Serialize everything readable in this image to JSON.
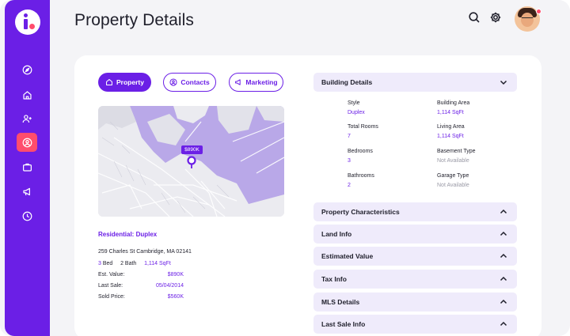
{
  "page_title": "Property Details",
  "tabs": [
    {
      "label": "Property",
      "icon": "home-icon",
      "active": true
    },
    {
      "label": "Contacts",
      "icon": "user-circle-icon",
      "active": false
    },
    {
      "label": "Marketing",
      "icon": "megaphone-icon",
      "active": false
    }
  ],
  "map": {
    "price_pin": "$890K"
  },
  "property": {
    "type": "Residential: Duplex",
    "address": "259 Charles St Cambridge, MA  02141",
    "beds_num": "3",
    "beds_label": "Bed",
    "baths_num": "2",
    "baths_label": "Bath",
    "area": "1,114 SqFt",
    "est_value_label": "Est. Value:",
    "est_value": "$890K",
    "last_sale_label": "Last Sale:",
    "last_sale": "05/04/2014",
    "sold_price_label": "Sold Price:",
    "sold_price": "$560K"
  },
  "building_details": {
    "title": "Building Details",
    "expanded": true,
    "fields": [
      {
        "label": "Style",
        "value": "Duplex"
      },
      {
        "label": "Building Area",
        "value": "1,114 SqFt"
      },
      {
        "label": "Total Rooms",
        "value": "7"
      },
      {
        "label": "Living Area",
        "value": "1,114 SqFt"
      },
      {
        "label": "Bedrooms",
        "value": "3"
      },
      {
        "label": "Basement Type",
        "value": "Not Available"
      },
      {
        "label": "Bathrooms",
        "value": "2"
      },
      {
        "label": "Garage Type",
        "value": "Not Available"
      }
    ]
  },
  "sections": [
    {
      "title": "Property Characteristics"
    },
    {
      "title": "Land Info"
    },
    {
      "title": "Estimated Value"
    },
    {
      "title": "Tax Info"
    },
    {
      "title": "MLS Details"
    },
    {
      "title": "Last Sale Info"
    }
  ],
  "sidebar_icons": [
    "compass-icon",
    "home-icon",
    "user-plus-icon",
    "user-circle-icon",
    "briefcase-icon",
    "megaphone-icon",
    "clock-icon"
  ],
  "colors": {
    "accent": "#6b1fe6",
    "sidebar": "#6b1fe6",
    "highlight": "#ff4d6d",
    "accordion_bg": "#efebfb",
    "water": "#b9a8e8"
  }
}
